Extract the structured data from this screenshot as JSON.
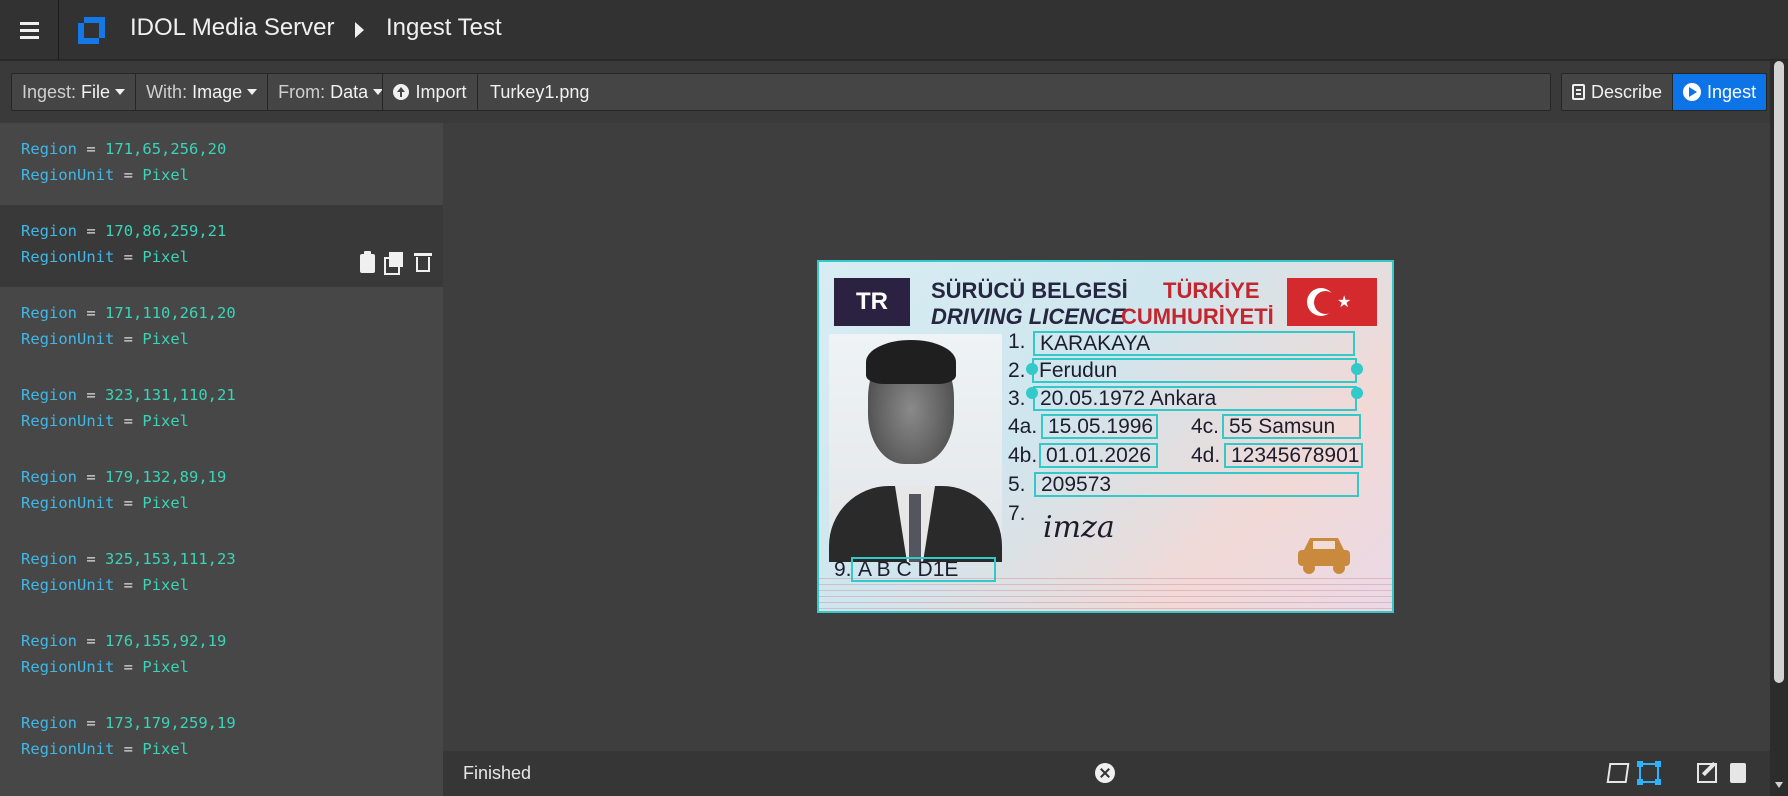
{
  "header": {
    "app_title": "IDOL Media Server",
    "page_title": "Ingest Test",
    "menu_icon": "hamburger-icon",
    "logo_icon": "idol-logo-icon",
    "breadcrumb_icon": "caret-right-icon"
  },
  "toolbar": {
    "ingest": {
      "label": "Ingest:",
      "value": "File"
    },
    "with": {
      "label": "With:",
      "value": "Image"
    },
    "from": {
      "label": "From:",
      "value": "Data"
    },
    "import_label": "Import",
    "file_name": "Turkey1.png",
    "describe_label": "Describe",
    "ingest_label": "Ingest",
    "accent_color": "#0d74e7"
  },
  "regions": [
    {
      "key": "Region",
      "value": "171,65,256,20",
      "unit_key": "RegionUnit",
      "unit_value": "Pixel"
    },
    {
      "key": "Region",
      "value": "170,86,259,21",
      "unit_key": "RegionUnit",
      "unit_value": "Pixel"
    },
    {
      "key": "Region",
      "value": "171,110,261,20",
      "unit_key": "RegionUnit",
      "unit_value": "Pixel"
    },
    {
      "key": "Region",
      "value": "323,131,110,21",
      "unit_key": "RegionUnit",
      "unit_value": "Pixel"
    },
    {
      "key": "Region",
      "value": "179,132,89,19",
      "unit_key": "RegionUnit",
      "unit_value": "Pixel"
    },
    {
      "key": "Region",
      "value": "325,153,111,23",
      "unit_key": "RegionUnit",
      "unit_value": "Pixel"
    },
    {
      "key": "Region",
      "value": "176,155,92,19",
      "unit_key": "RegionUnit",
      "unit_value": "Pixel"
    },
    {
      "key": "Region",
      "value": "173,179,259,19",
      "unit_key": "RegionUnit",
      "unit_value": "Pixel"
    }
  ],
  "region_operator": "=",
  "card": {
    "country_code": "TR",
    "title_tr": "SÜRÜCÜ BELGESİ",
    "title_en": "DRIVING LICENCE",
    "country_line1": "TÜRKİYE",
    "country_line2": "CUMHURİYETİ",
    "fields": [
      {
        "num": "1.",
        "value": "KARAKAYA"
      },
      {
        "num": "2.",
        "value": "Ferudun"
      },
      {
        "num": "3.",
        "value": "20.05.1972 Ankara"
      },
      {
        "num": "4a.",
        "value": "15.05.1996"
      },
      {
        "num": "4c.",
        "value": "55 Samsun"
      },
      {
        "num": "4b.",
        "value": "01.01.2026"
      },
      {
        "num": "4d.",
        "value": "12345678901"
      },
      {
        "num": "5.",
        "value": "209573"
      },
      {
        "num": "7.",
        "value": ""
      },
      {
        "num": "9.",
        "value": "A B C D1E"
      }
    ],
    "signature": "imza",
    "highlight_color": "#33c9c9"
  },
  "status": {
    "text": "Finished"
  }
}
